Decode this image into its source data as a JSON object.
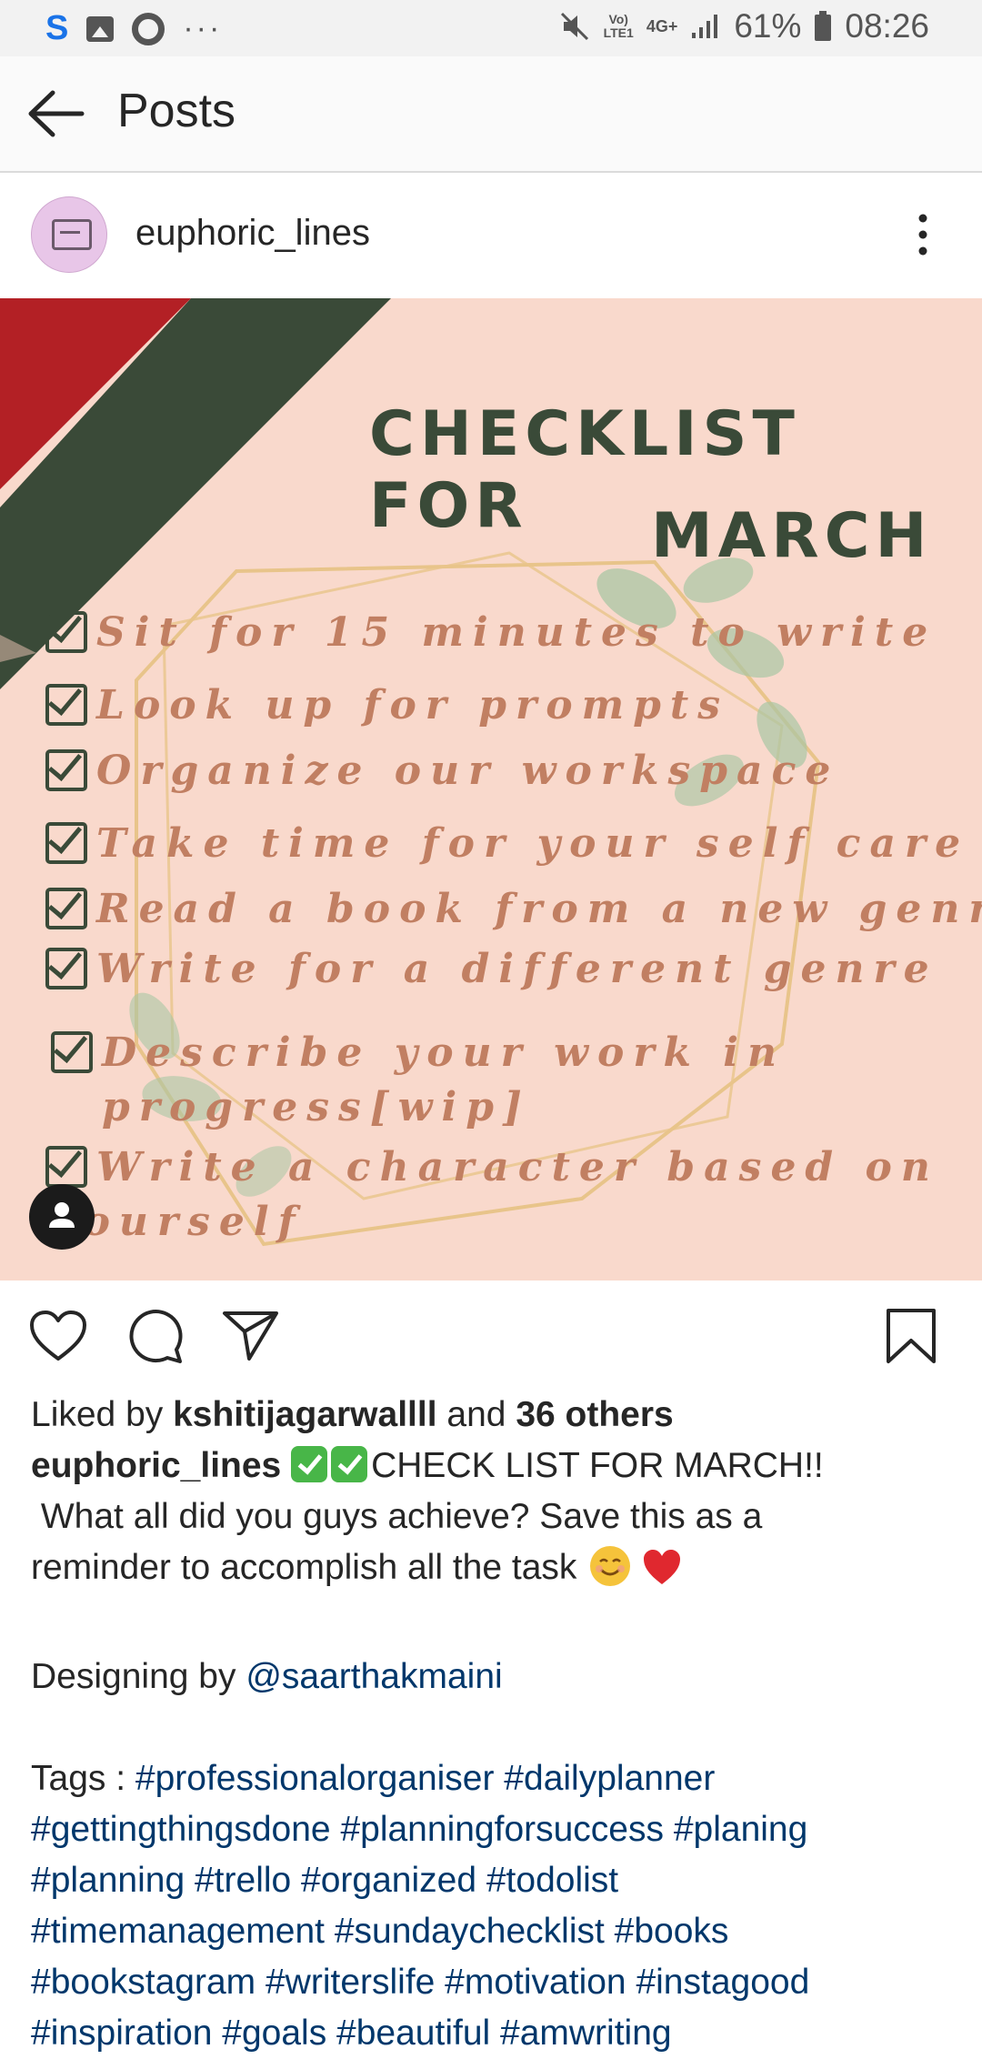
{
  "status_bar": {
    "network_top": "Vo)",
    "network_bottom": "LTE1",
    "network_type": "4G+",
    "battery": "61%",
    "time": "08:26"
  },
  "header": {
    "title": "Posts"
  },
  "post": {
    "username": "euphoric_lines",
    "image": {
      "title_line1": "CHECKLIST FOR",
      "title_line2": "MARCH",
      "items": [
        "Sit for 15 minutes to write",
        "Look up for prompts",
        "Organize our workspace",
        "Take time for your self care",
        "Read a book from a new genre",
        "Write for a different genre",
        "Describe your work in",
        "progress[wip]",
        "Write  a character based on",
        "yourself"
      ],
      "colors": {
        "background": "#f9d9cc",
        "green": "#3a4a38",
        "red": "#b32025",
        "text": "#c17f62"
      }
    },
    "likes": {
      "prefix": "Liked by",
      "user": "kshitijagarwallll",
      "middle": "and",
      "others": "36 others"
    },
    "caption": {
      "username": "euphoric_lines",
      "line1": "CHECK LIST FOR MARCH!!",
      "line2": " What all did you guys achieve? Save this as a",
      "line3": "reminder to accomplish all the task",
      "designing_prefix": "Designing by",
      "mention": "@saarthakmaini",
      "tags_prefix": "Tags :",
      "tags_line1": "#professionalorganiser #dailyplanner",
      "tags_line2": "#gettingthingsdone #planningforsuccess #planing",
      "tags_line3": "#planning #trello #organized #todolist",
      "tags_line4": "#timemanagement #sundaychecklist #books",
      "tags_line5": "#bookstagram #writerslife #motivation #instagood",
      "tags_line6": "#inspiration #goals #beautiful #amwriting"
    }
  }
}
